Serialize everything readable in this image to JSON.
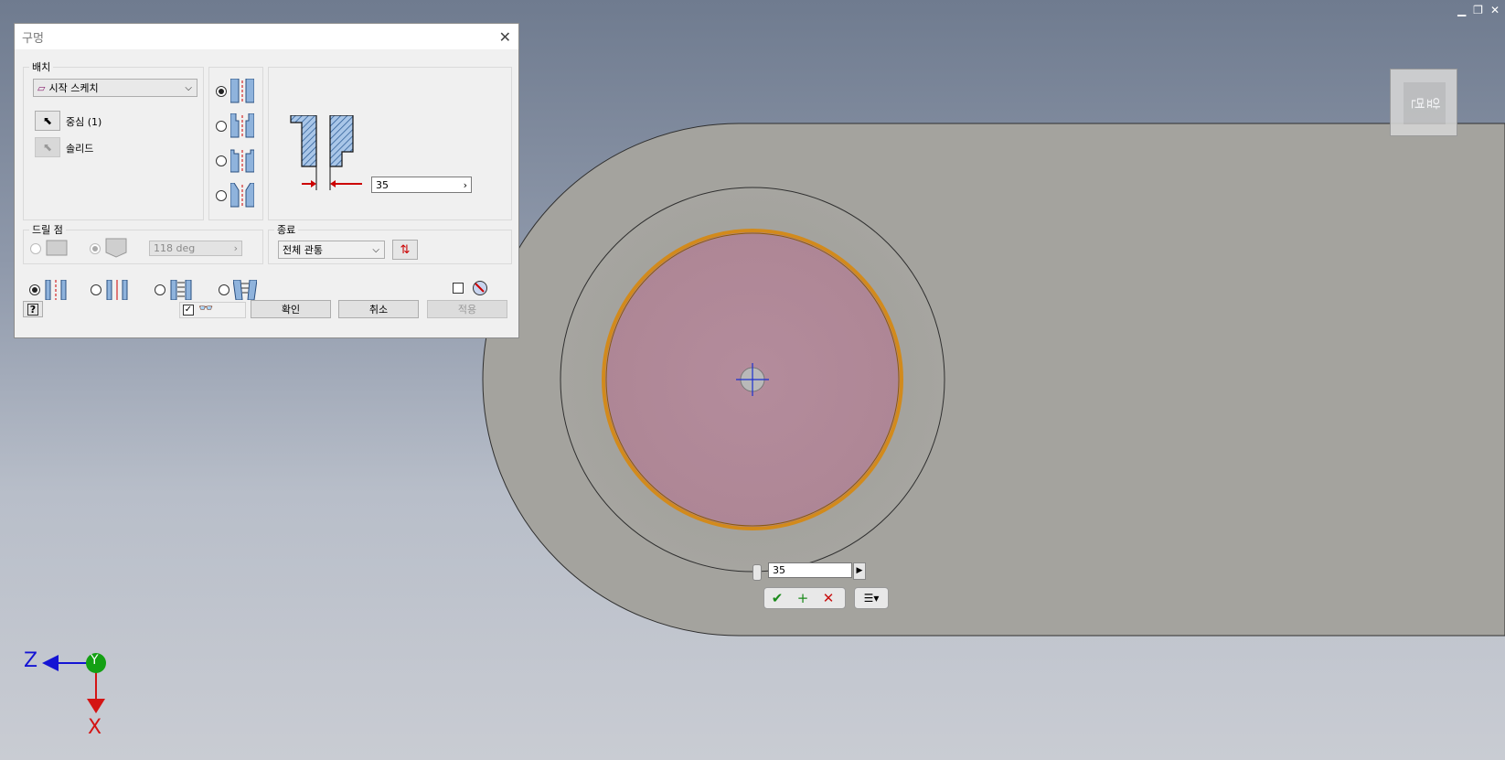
{
  "window_controls": {
    "minimize": "▁",
    "restore": "❐",
    "close": "✕"
  },
  "viewcube": {
    "face_label": "앞면"
  },
  "triad": {
    "z_label": "Z",
    "y_label": "Y",
    "x_label": "X",
    "colors": {
      "z": "#1414d4",
      "y": "#14a014",
      "x": "#d41414"
    }
  },
  "dialog": {
    "title": "구멍",
    "placement": {
      "legend": "배치",
      "type_value": "시작 스케치",
      "center_label": "중심 (1)",
      "solid_label": "솔리드"
    },
    "hole_types": [
      "drilled",
      "counterbore",
      "spotface",
      "countersink"
    ],
    "diameter_value": "35",
    "drill_point": {
      "legend": "드릴 점",
      "angle_value": "118 deg"
    },
    "termination": {
      "legend": "종료",
      "value": "전체 관통"
    },
    "thread_types": [
      "simple",
      "clearance",
      "tapped",
      "taper-tapped"
    ],
    "buttons": {
      "ok": "확인",
      "cancel": "취소",
      "apply": "적용"
    }
  },
  "minitoolbar": {
    "value": "35"
  },
  "accent_colors": {
    "hole_face": "#b08898",
    "hole_edge": "#d28a1c",
    "part": "#a3a29d"
  }
}
